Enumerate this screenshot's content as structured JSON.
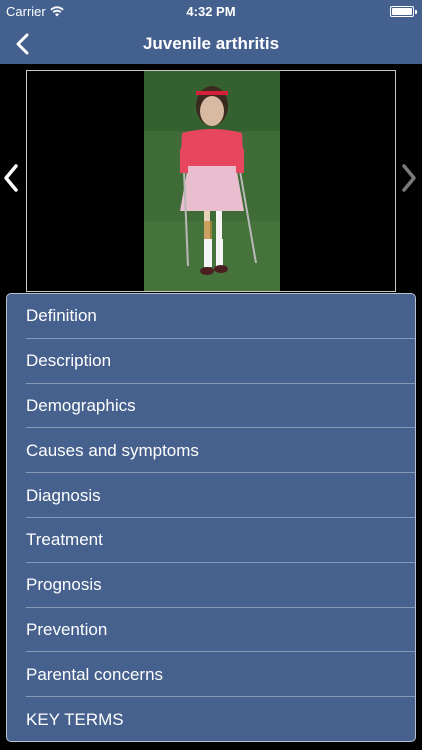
{
  "status_bar": {
    "carrier": "Carrier",
    "time": "4:32 PM"
  },
  "nav": {
    "title": "Juvenile arthritis",
    "back_icon": "chevron-left-icon"
  },
  "gallery": {
    "prev_icon": "chevron-left-icon",
    "next_icon": "chevron-right-icon"
  },
  "colors": {
    "nav_background": "#44608f",
    "menu_background": "#46618e",
    "separator": "#8797b6"
  },
  "menu": {
    "items": [
      {
        "label": "Definition"
      },
      {
        "label": "Description"
      },
      {
        "label": "Demographics"
      },
      {
        "label": "Causes and symptoms"
      },
      {
        "label": "Diagnosis"
      },
      {
        "label": "Treatment"
      },
      {
        "label": "Prognosis"
      },
      {
        "label": "Prevention"
      },
      {
        "label": "Parental concerns"
      },
      {
        "label": "KEY TERMS"
      }
    ]
  }
}
